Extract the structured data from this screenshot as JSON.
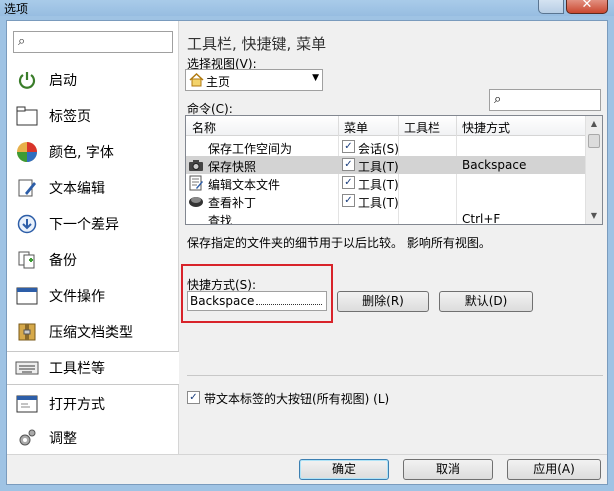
{
  "window": {
    "title": "选项"
  },
  "sidebar": {
    "items": [
      {
        "label": "启动",
        "icon": "power-icon"
      },
      {
        "label": "标签页",
        "icon": "tab-icon"
      },
      {
        "label": "颜色, 字体",
        "icon": "palette-icon"
      },
      {
        "label": "文本编辑",
        "icon": "pencil-icon"
      },
      {
        "label": "下一个差异",
        "icon": "down-arrow-icon"
      },
      {
        "label": "备份",
        "icon": "backup-icon"
      },
      {
        "label": "文件操作",
        "icon": "file-operation-icon"
      },
      {
        "label": "压缩文档类型",
        "icon": "archive-icon"
      },
      {
        "label": "工具栏等",
        "icon": "keyboard-icon",
        "selected": true
      },
      {
        "label": "打开方式",
        "icon": "open-with-icon"
      },
      {
        "label": "调整",
        "icon": "gear-icon"
      }
    ]
  },
  "main": {
    "section_title": "工具栏, 快捷键, 菜单",
    "view_label": "选择视图(V):",
    "view_value": "主页",
    "commands_label": "命令(C):",
    "columns": [
      "名称",
      "菜单",
      "工具栏",
      "快捷方式"
    ],
    "rows": [
      {
        "name": "保存工作空间为",
        "menu": "会话(S)",
        "menu_checked": true,
        "toolbar": "",
        "shortcut": "",
        "icon": ""
      },
      {
        "name": "保存快照",
        "menu": "工具(T)",
        "menu_checked": true,
        "toolbar": "",
        "shortcut": "Backspace",
        "icon": "camera-icon",
        "selected": true
      },
      {
        "name": "编辑文本文件",
        "menu": "工具(T)",
        "menu_checked": true,
        "toolbar": "",
        "shortcut": "",
        "icon": "edit-file-icon"
      },
      {
        "name": "查看补丁",
        "menu": "工具(T)",
        "menu_checked": true,
        "toolbar": "",
        "shortcut": "",
        "icon": "patch-icon"
      },
      {
        "name": "查找",
        "menu": "",
        "menu_checked": false,
        "toolbar": "",
        "shortcut": "Ctrl+F",
        "icon": ""
      }
    ],
    "description": "保存指定的文件夹的细节用于以后比较。 影响所有视图。",
    "shortcut_label": "快捷方式(S):",
    "shortcut_value": "Backspace",
    "delete_button": "删除(R)",
    "default_button": "默认(D)",
    "large_buttons_label": "带文本标签的大按钮(所有视图) (L)",
    "large_buttons_checked": true
  },
  "footer": {
    "ok": "确定",
    "cancel": "取消",
    "apply": "应用(A)"
  }
}
